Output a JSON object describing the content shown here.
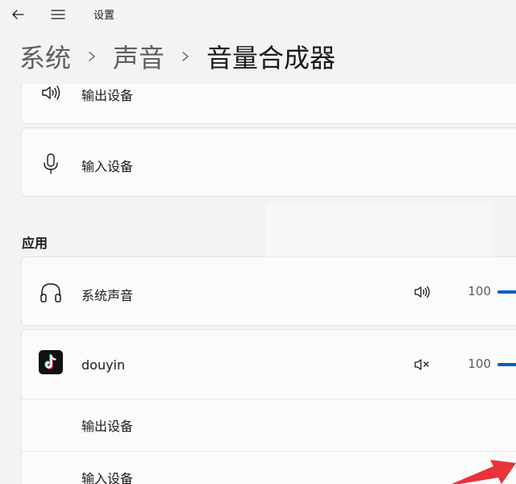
{
  "window": {
    "title": "设置",
    "back_icon": "back-arrow-icon",
    "menu_icon": "hamburger-menu-icon"
  },
  "breadcrumb": {
    "items": [
      "系统",
      "声音",
      "音量合成器"
    ],
    "separator_icon": "chevron-right-icon"
  },
  "devices": {
    "output": {
      "label": "输出设备",
      "icon": "speaker-icon"
    },
    "input": {
      "label": "输入设备",
      "icon": "microphone-icon"
    }
  },
  "apps": {
    "section_title": "应用",
    "items": [
      {
        "label": "系统声音",
        "icon": "headphones-icon",
        "volume_icon": "speaker-icon",
        "muted": false,
        "volume": "100"
      },
      {
        "label": "douyin",
        "icon": "tiktok-logo-icon",
        "volume_icon": "speaker-muted-icon",
        "muted": true,
        "volume": "100",
        "expanded": true,
        "sub_items": [
          {
            "label": "输出设备"
          },
          {
            "label": "输入设备"
          }
        ]
      }
    ]
  },
  "colors": {
    "accent": "#005fb8",
    "background": "#f3f3f3",
    "card": "#fbfbfb",
    "annotation_arrow": "#e8333a"
  }
}
